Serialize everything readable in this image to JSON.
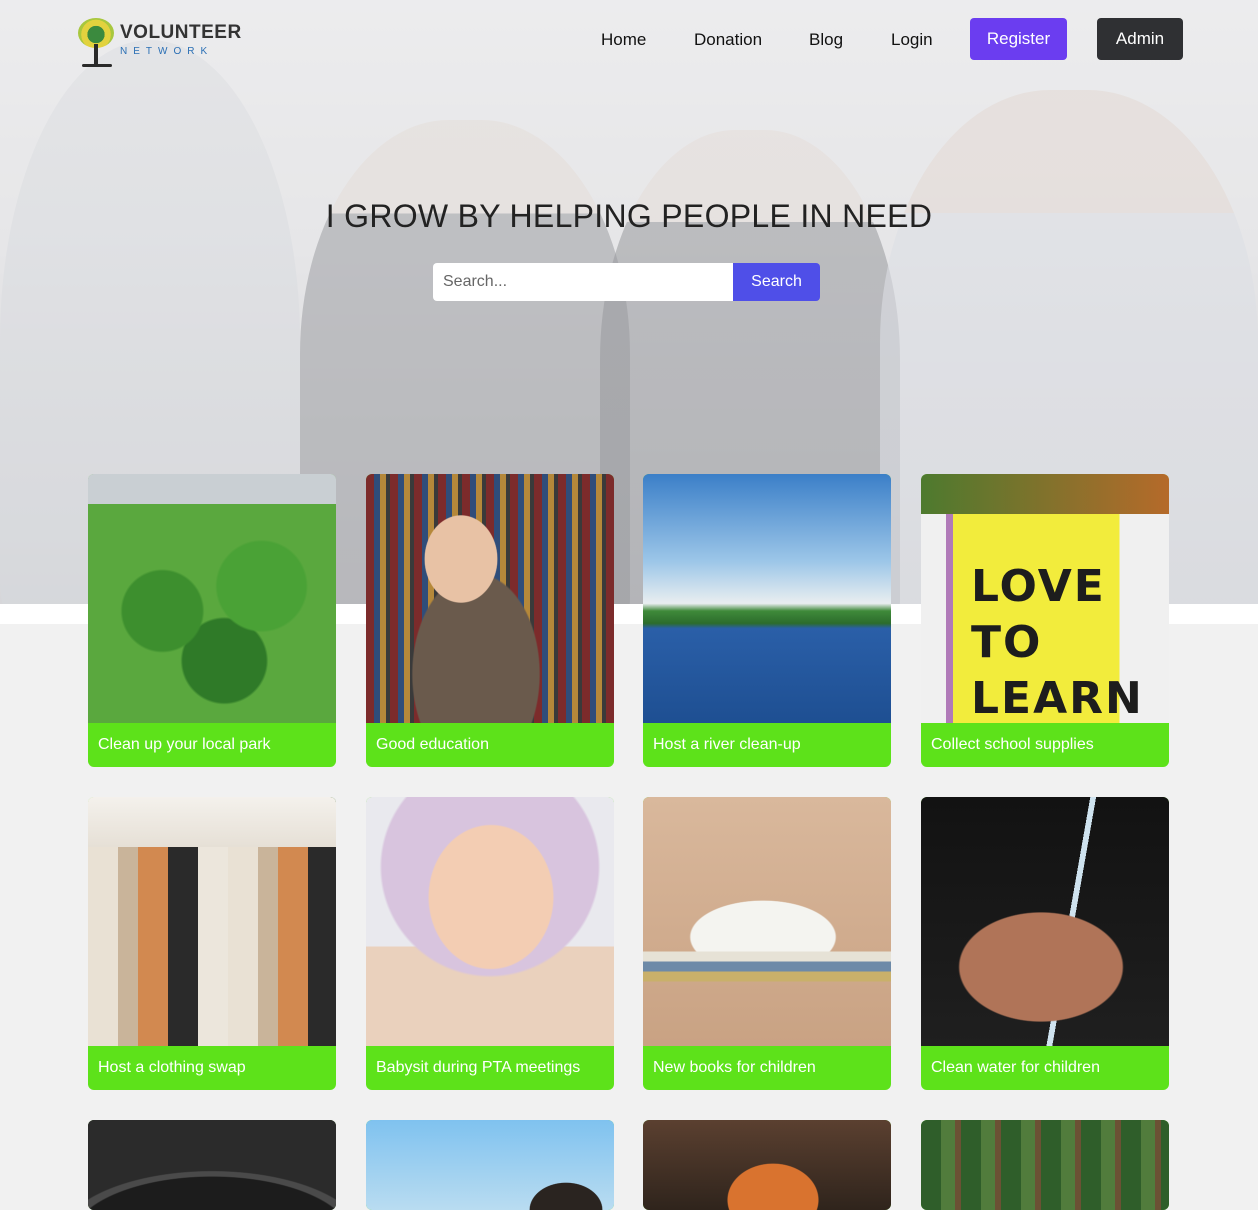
{
  "brand": {
    "name": "VOLUNTEER",
    "sub": "NETWORK"
  },
  "nav": {
    "home": "Home",
    "donation": "Donation",
    "blog": "Blog",
    "login": "Login",
    "register": "Register",
    "admin": "Admin"
  },
  "colors": {
    "register": "#6b3df0",
    "admin": "#2f3033",
    "search_button": "#4f4fe8",
    "card_label_bg": "#5de21a"
  },
  "hero": {
    "headline": "I GROW BY HELPING PEOPLE IN NEED"
  },
  "search": {
    "placeholder": "Search...",
    "button": "Search"
  },
  "cards": [
    {
      "label": "Clean up your local park",
      "icon": "park-image"
    },
    {
      "label": "Good education",
      "icon": "library-image"
    },
    {
      "label": "Host a river clean-up",
      "icon": "river-image"
    },
    {
      "label": "Collect school supplies",
      "icon": "pencil-sign-image",
      "sign_text": "LOVE TO LEARN"
    },
    {
      "label": "Host a clothing swap",
      "icon": "clothes-rack-image"
    },
    {
      "label": "Babysit during PTA meetings",
      "icon": "baby-image"
    },
    {
      "label": "New books for children",
      "icon": "books-image"
    },
    {
      "label": "Clean water for children",
      "icon": "water-hands-image"
    }
  ]
}
